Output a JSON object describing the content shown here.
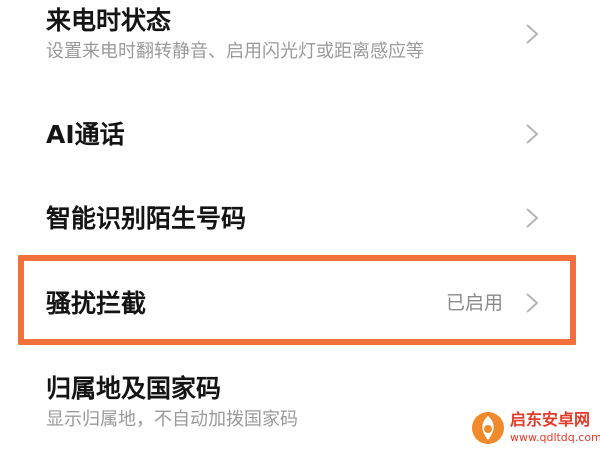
{
  "settings": {
    "items": [
      {
        "title": "来电时状态",
        "subtitle": "设置来电时翻转静音、启用闪光灯或距离感应等"
      },
      {
        "title": "AI通话"
      },
      {
        "title": "智能识别陌生号码"
      },
      {
        "title": "骚扰拦截",
        "value": "已启用"
      },
      {
        "title": "归属地及国家码",
        "subtitle": "显示归属地，不自动加拨国家码"
      }
    ]
  },
  "watermark": {
    "name": "启东安卓网",
    "url": "www.qdltdq.com"
  },
  "colors": {
    "highlight": "#f2703c",
    "title": "#141414",
    "subtitle": "#9a9a9a",
    "chevron": "#b5b5b5",
    "watermark": "#e23b2a"
  },
  "icons": {
    "chevron": "chevron-right-icon",
    "watermark_logo": "watermark-logo-icon"
  }
}
